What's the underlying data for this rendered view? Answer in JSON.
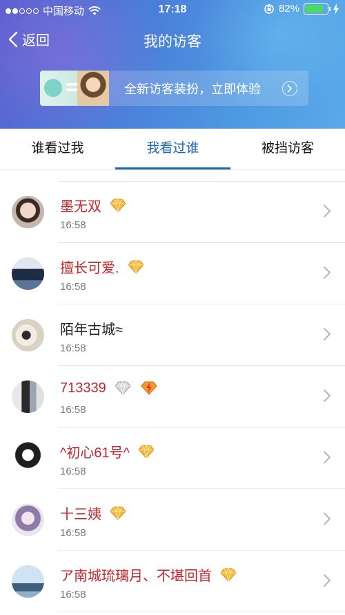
{
  "status_bar": {
    "carrier": "中国移动",
    "time": "17:18",
    "battery_percent": "82%",
    "battery_level": 0.82,
    "wifi_icon": "wifi-icon",
    "orientation_lock_icon": "orientation-lock-icon",
    "charging_icon": "charging-bolt-icon"
  },
  "nav": {
    "back_label": "返回",
    "title": "我的访客"
  },
  "banner": {
    "text": "全新访客装扮，立即体验",
    "arrow_icon": "arrow-right-circle-icon"
  },
  "tabs": [
    {
      "label": "谁看过我",
      "active": false
    },
    {
      "label": "我看过谁",
      "active": true
    },
    {
      "label": "被挡访客",
      "active": false
    }
  ],
  "colors": {
    "accent": "#1a63b3",
    "vip_name": "#c4262c",
    "time_text": "#777777"
  },
  "visitors": [
    {
      "name": "墨无双",
      "time": "16:58",
      "vip": true,
      "badges": [
        "gold-diamond-icon"
      ]
    },
    {
      "name": "擅长可爱.",
      "time": "16:58",
      "vip": true,
      "badges": [
        "gold-diamond-icon"
      ]
    },
    {
      "name": "陌年古城≈",
      "time": "16:58",
      "vip": false,
      "badges": []
    },
    {
      "name": "713339",
      "time": "16:58",
      "vip": true,
      "badges": [
        "silver-diamond-icon",
        "super-vip-diamond-icon"
      ]
    },
    {
      "name": "^初心61号^",
      "time": "16:58",
      "vip": true,
      "badges": [
        "gold-diamond-icon"
      ]
    },
    {
      "name": "十三姨",
      "time": "16:58",
      "vip": true,
      "badges": [
        "gold-diamond-icon"
      ]
    },
    {
      "name": "ア南城琉璃月、不堪回首",
      "time": "16:58",
      "vip": true,
      "badges": [
        "gold-diamond-icon"
      ]
    }
  ]
}
